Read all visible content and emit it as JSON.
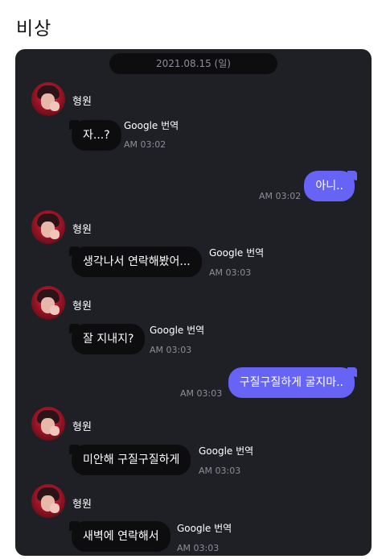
{
  "post": {
    "title": "비상"
  },
  "chat": {
    "date": "2021.08.15 (일)",
    "translate_label": "Google 번역",
    "messages": [
      {
        "direction": "in",
        "sender": "형원",
        "text": "자...?",
        "time": "AM 03:02"
      },
      {
        "direction": "out",
        "text": "아니..",
        "time": "AM 03:02"
      },
      {
        "direction": "in",
        "sender": "형원",
        "text": "생각나서 연락해봤어...",
        "time": "AM 03:03"
      },
      {
        "direction": "in",
        "sender": "형원",
        "text": "잘 지내지?",
        "time": "AM 03:03"
      },
      {
        "direction": "out",
        "text": "구질구질하게 굴지마..",
        "time": "AM 03:03"
      },
      {
        "direction": "in",
        "sender": "형원",
        "text": "미안해 구질구질하게",
        "time": "AM 03:03"
      },
      {
        "direction": "in",
        "sender": "형원",
        "text": "새벽에 연락해서",
        "time": "AM 03:03"
      }
    ]
  },
  "colors": {
    "chat_bg": "#1f2025",
    "incoming_bubble": "#0d0d0f",
    "outgoing_bubble": "#6663f5",
    "meta_text": "#8d8e95"
  }
}
